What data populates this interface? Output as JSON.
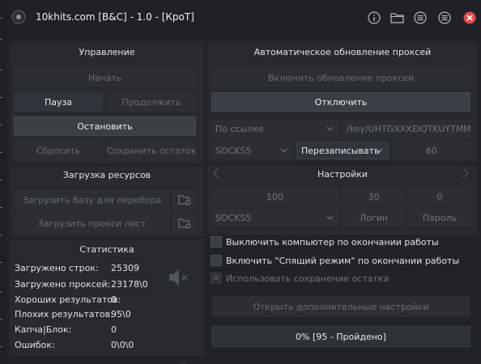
{
  "window": {
    "title": "10khits.com [B&C] - 1.0 - [КроТ]",
    "title_icons": [
      "info-icon",
      "folder-icon",
      "list-icon",
      "menu-icon",
      "close-icon"
    ]
  },
  "control": {
    "header": "Управление",
    "start": "Начать",
    "pause": "Пауза",
    "resume": "Продолжить",
    "stop": "Остановить",
    "reset": "Сбросить",
    "save_rest": "Сохранить остаток"
  },
  "resources": {
    "header": "Загрузка ресурсов",
    "load_base": "Загрузить базу для перебора",
    "load_proxy": "Загрузить прокси лист"
  },
  "stats": {
    "header": "Статистика",
    "rows": [
      {
        "label": "Загружено строк:",
        "value": "25309"
      },
      {
        "label": "Загружено проксей:",
        "value": "23178\\0"
      },
      {
        "label": "Хороших результатов:",
        "value": "0"
      },
      {
        "label": "Плохих результатов:",
        "value": "95\\0"
      },
      {
        "label": "Капча|Блок:",
        "value": "0"
      },
      {
        "label": "Ошибок:",
        "value": "0\\0\\0"
      }
    ]
  },
  "autoproxy": {
    "header": "Автоматическое обновление проксей",
    "enable": "Включить обновление проксей",
    "disable": "Отключить",
    "source_select": "По ссылке",
    "url_value": "/key/UHTGXXXEIQTKUYTMMZIYC",
    "type_select": "SOCKS5",
    "mode_select": "Перезаписывать",
    "interval": "60"
  },
  "settings": {
    "header": "Настройки",
    "threads": "100",
    "timeout": "30",
    "retries": "0",
    "proxy_type": "SOCKS5",
    "login_placeholder": "Логин",
    "password_placeholder": "Пароль",
    "opt_shutdown": "Выключить компьютер по окончании работы",
    "opt_sleep": "Включить \"Спящий режим\" по окончании работы",
    "opt_save_rest": "Использовать сохранение остатка",
    "advanced": "Открыть дополнительные настройки"
  },
  "progress": {
    "text": "0% [95 - Пройдено]",
    "fraction": 0.0
  },
  "colors": {
    "background": "#202429",
    "panel": "#272b30",
    "button": "#30353b",
    "close": "#e34b4b"
  }
}
